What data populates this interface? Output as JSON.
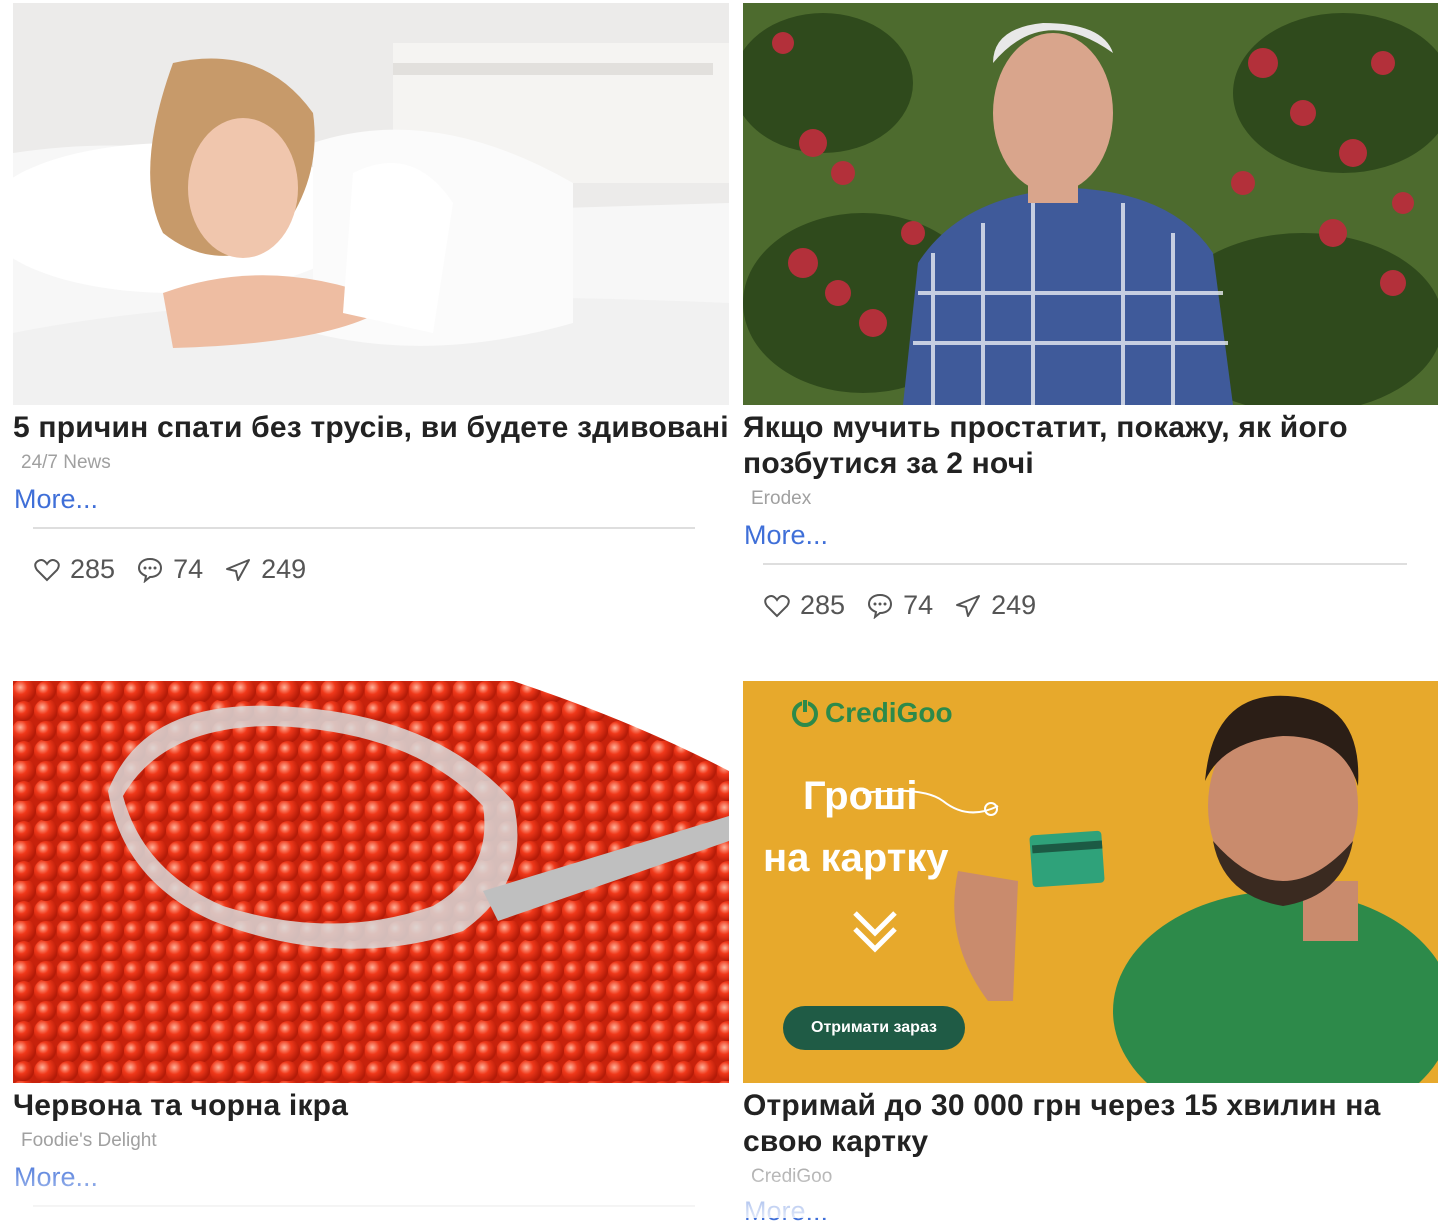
{
  "cards": [
    {
      "headline": "5 причин спати без трусів, ви будете здивовані",
      "source": "24/7 News",
      "more": "More...",
      "likes": "285",
      "comments": "74",
      "shares": "249"
    },
    {
      "headline": "Якщо мучить простатит, покажу, як його позбутися за 2 ночі",
      "source": "Erodex",
      "more": "More...",
      "likes": "285",
      "comments": "74",
      "shares": "249"
    },
    {
      "headline": "Червона та чорна ікра",
      "source": "Foodie's Delight",
      "more": "More..."
    },
    {
      "headline": "Отримай до 30 000 грн через 15 хвилин на свою картку",
      "source": "CrediGoo",
      "more": "More...",
      "ad": {
        "brand": "CrediGoo",
        "line1": "Гроші",
        "line2": "на картку",
        "cta": "Отримати зараз"
      }
    }
  ],
  "colors": {
    "link": "#3f6fd8",
    "ad_background": "#e7a92c",
    "ad_cta": "#1f5b45"
  }
}
